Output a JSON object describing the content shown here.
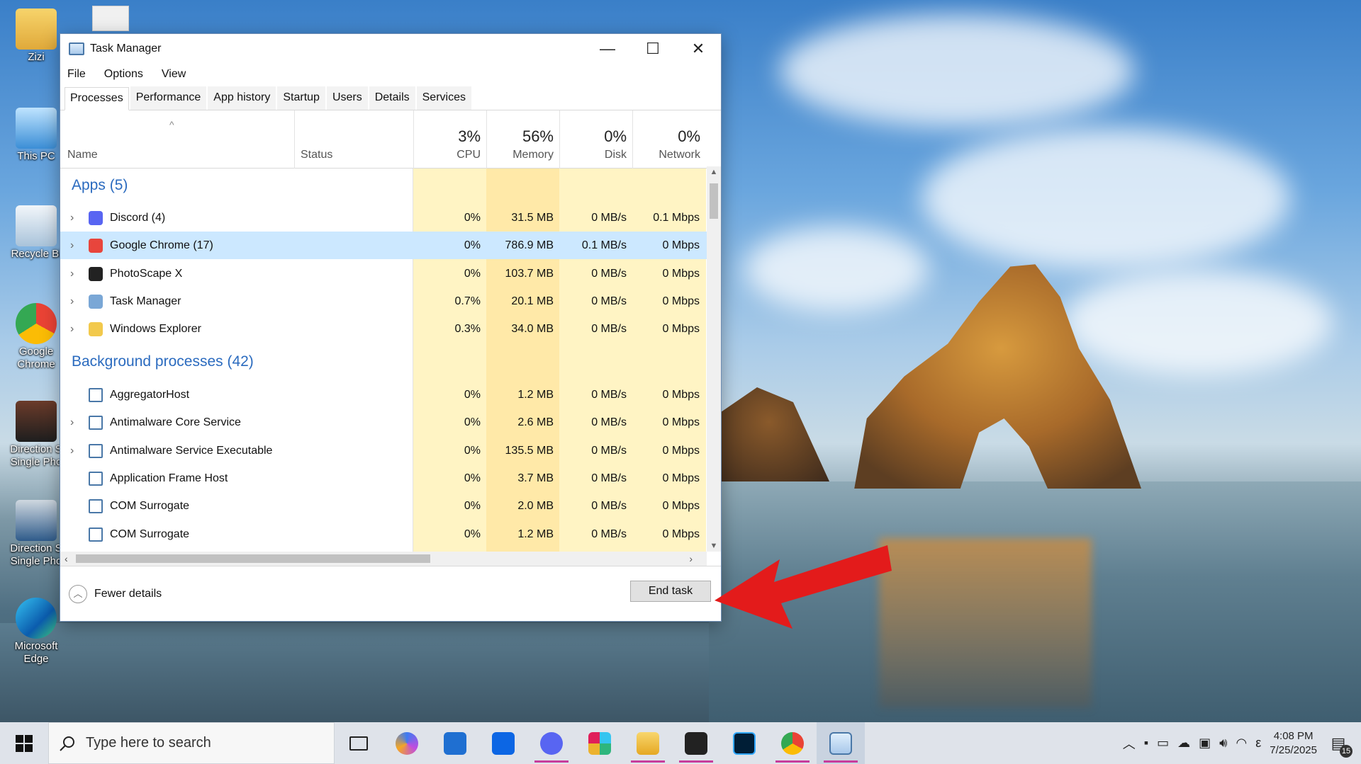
{
  "desktop": {
    "icons": [
      {
        "label": "Zizi"
      },
      {
        "label": "This PC"
      },
      {
        "label": "Recycle Bi"
      },
      {
        "label": "Google Chrome"
      },
      {
        "label": "Direction S Single Pho"
      },
      {
        "label": "Direction S Single Pho"
      },
      {
        "label": "Microsoft Edge"
      }
    ]
  },
  "window": {
    "title": "Task Manager",
    "controls": {
      "minimize": "—",
      "maximize": "☐",
      "close": "✕"
    },
    "menu": [
      "File",
      "Options",
      "View"
    ],
    "tabs": [
      "Processes",
      "Performance",
      "App history",
      "Startup",
      "Users",
      "Details",
      "Services"
    ],
    "active_tab": "Processes"
  },
  "columns": {
    "name": "Name",
    "status": "Status",
    "cpu": {
      "pct": "3%",
      "label": "CPU"
    },
    "memory": {
      "pct": "56%",
      "label": "Memory"
    },
    "disk": {
      "pct": "0%",
      "label": "Disk"
    },
    "network": {
      "pct": "0%",
      "label": "Network"
    }
  },
  "groups": {
    "apps": "Apps (5)",
    "background": "Background processes (42)"
  },
  "apps": [
    {
      "name": "Discord (4)",
      "cpu": "0%",
      "memory": "31.5 MB",
      "disk": "0 MB/s",
      "network": "0.1 Mbps",
      "icon": "discord-icon",
      "color": "#5865f2"
    },
    {
      "name": "Google Chrome (17)",
      "cpu": "0%",
      "memory": "786.9 MB",
      "disk": "0.1 MB/s",
      "network": "0 Mbps",
      "icon": "chrome-icon",
      "color": "#e8453c"
    },
    {
      "name": "PhotoScape X",
      "cpu": "0%",
      "memory": "103.7 MB",
      "disk": "0 MB/s",
      "network": "0 Mbps",
      "icon": "photoscape-icon",
      "color": "#222222"
    },
    {
      "name": "Task Manager",
      "cpu": "0.7%",
      "memory": "20.1 MB",
      "disk": "0 MB/s",
      "network": "0 Mbps",
      "icon": "task-manager-icon",
      "color": "#7aa7d6"
    },
    {
      "name": "Windows Explorer",
      "cpu": "0.3%",
      "memory": "34.0 MB",
      "disk": "0 MB/s",
      "network": "0 Mbps",
      "icon": "folder-icon",
      "color": "#f2c94c"
    }
  ],
  "background": [
    {
      "name": "AggregatorHost",
      "cpu": "0%",
      "memory": "1.2 MB",
      "disk": "0 MB/s",
      "network": "0 Mbps"
    },
    {
      "name": "Antimalware Core Service",
      "cpu": "0%",
      "memory": "2.6 MB",
      "disk": "0 MB/s",
      "network": "0 Mbps"
    },
    {
      "name": "Antimalware Service Executable",
      "cpu": "0%",
      "memory": "135.5 MB",
      "disk": "0 MB/s",
      "network": "0 Mbps"
    },
    {
      "name": "Application Frame Host",
      "cpu": "0%",
      "memory": "3.7 MB",
      "disk": "0 MB/s",
      "network": "0 Mbps"
    },
    {
      "name": "COM Surrogate",
      "cpu": "0%",
      "memory": "2.0 MB",
      "disk": "0 MB/s",
      "network": "0 Mbps"
    },
    {
      "name": "COM Surrogate",
      "cpu": "0%",
      "memory": "1.2 MB",
      "disk": "0 MB/s",
      "network": "0 Mbps"
    }
  ],
  "footer": {
    "fewer_details": "Fewer details",
    "end_task": "End task"
  },
  "taskbar": {
    "search_placeholder": "Type here to search",
    "time": "4:08 PM",
    "date": "7/25/2025",
    "notification_count": "15",
    "lang": "ε"
  },
  "colors": {
    "cpu_bg": "#fff4c4",
    "mem_bg": "#ffe9a8",
    "selected_row": "#cce8ff",
    "group_text": "#2b6bbf",
    "arrow": "#e31b1b"
  }
}
